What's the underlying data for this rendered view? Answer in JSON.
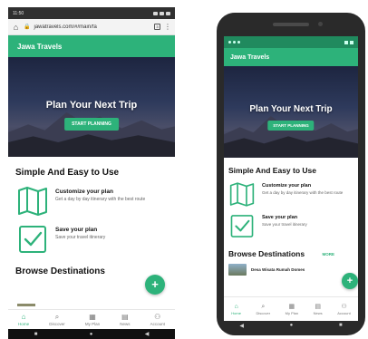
{
  "browser": {
    "status_time": "11:50",
    "url": "jawatravels.com/#/main/fa",
    "tab_count": "3"
  },
  "app": {
    "brand": "Jawa Travels",
    "hero_title": "Plan Your Next Trip",
    "hero_button": "START PLANNING",
    "simple_title": "Simple And Easy to Use",
    "features": [
      {
        "title": "Customize your plan",
        "desc": "Get a day by day itinerary with the best route",
        "icon": "map-icon"
      },
      {
        "title": "Save your plan",
        "desc": "Save your travel itinerary",
        "icon": "checkbox-icon"
      }
    ],
    "browse_title": "Browse Destinations",
    "more_label": "MORE",
    "destination_1": "Desa Wisata Rumah Domes",
    "fab_label": "+",
    "nav": [
      {
        "label": "Home",
        "icon": "home-icon"
      },
      {
        "label": "Discover",
        "icon": "search-icon"
      },
      {
        "label": "My Plan",
        "icon": "calendar-icon"
      },
      {
        "label": "News",
        "icon": "news-icon"
      },
      {
        "label": "Account",
        "icon": "account-icon"
      }
    ]
  },
  "colors": {
    "accent": "#2db27a",
    "status_dark": "#208a5e"
  }
}
